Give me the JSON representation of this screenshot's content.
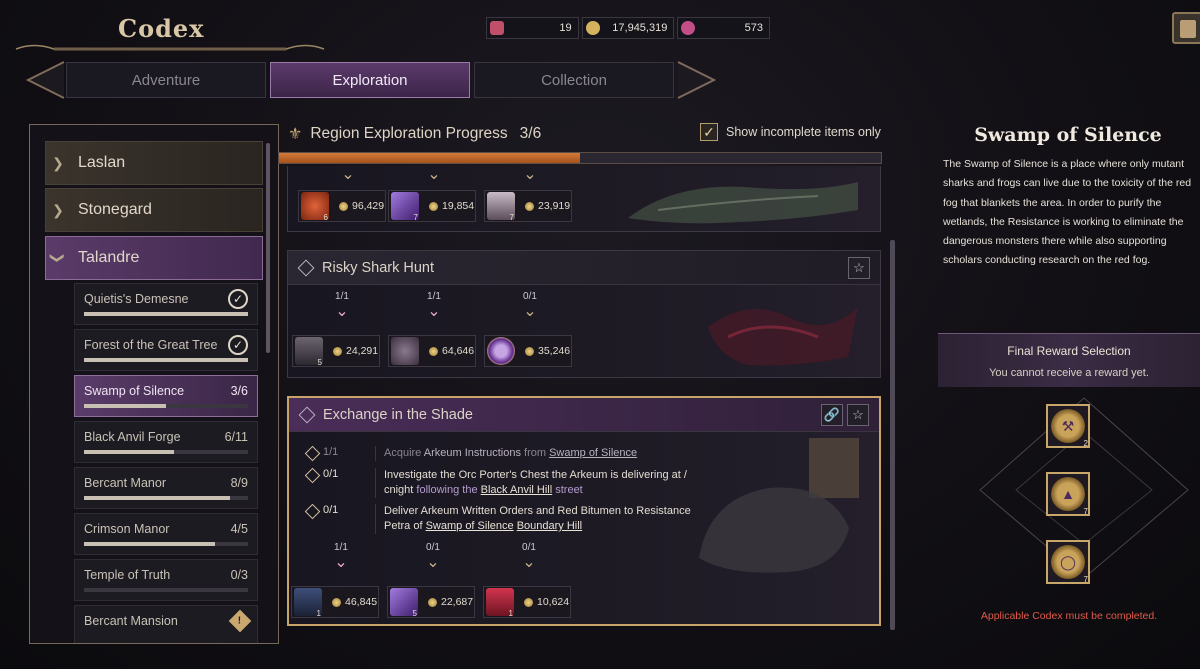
{
  "header": {
    "title": "Codex",
    "currencies": [
      {
        "icon": "scroll-icon",
        "value": "19",
        "color": "#c0506a"
      },
      {
        "icon": "gold-coin-icon",
        "value": "17,945,319",
        "color": "#d4b25e"
      },
      {
        "icon": "gem-icon",
        "value": "573",
        "color": "#c24d87"
      }
    ]
  },
  "tabs": [
    {
      "label": "Adventure",
      "active": false
    },
    {
      "label": "Exploration",
      "active": true
    },
    {
      "label": "Collection",
      "active": false
    }
  ],
  "regions": [
    {
      "label": "Laslan",
      "open": false
    },
    {
      "label": "Stonegard",
      "open": false
    },
    {
      "label": "Talandre",
      "open": true
    }
  ],
  "subregions": [
    {
      "label": "Quietis's Demesne",
      "progress": "",
      "complete": true,
      "fill": 1.0
    },
    {
      "label": "Forest of the Great Tree",
      "progress": "",
      "complete": true,
      "fill": 1.0
    },
    {
      "label": "Swamp of Silence",
      "progress": "3/6",
      "complete": false,
      "fill": 0.5,
      "active": true
    },
    {
      "label": "Black Anvil Forge",
      "progress": "6/11",
      "complete": false,
      "fill": 0.55
    },
    {
      "label": "Bercant Manor",
      "progress": "8/9",
      "complete": false,
      "fill": 0.89
    },
    {
      "label": "Crimson Manor",
      "progress": "4/5",
      "complete": false,
      "fill": 0.8
    },
    {
      "label": "Temple of Truth",
      "progress": "0/3",
      "complete": false,
      "fill": 0.0
    },
    {
      "label": "Bercant Mansion",
      "progress": "",
      "complete": false,
      "warning": true
    }
  ],
  "exploration": {
    "title": "Region Exploration Progress",
    "progress": "3/6",
    "progress_fill": 0.5,
    "show_incomplete_label": "Show incomplete items only",
    "show_incomplete_checked": true
  },
  "cards": {
    "top": {
      "slots": [
        {
          "item_color": "#b8431c",
          "qty": "6",
          "value": "96,429"
        },
        {
          "item_color": "#6a3fa0",
          "qty": "7",
          "value": "19,854"
        },
        {
          "item_color": "#7a6a80",
          "qty": "7",
          "value": "23,919"
        }
      ]
    },
    "shark": {
      "title": "Risky Shark Hunt",
      "tiers": [
        "1/1",
        "1/1",
        "0/1"
      ],
      "slots": [
        {
          "item_color": "#4b4550",
          "qty": "5",
          "value": "24,291"
        },
        {
          "item_color": "#5a4a5e",
          "qty": "",
          "value": "64,646"
        },
        {
          "item_color": "#7c3fb0",
          "qty": "",
          "value": "35,246"
        }
      ]
    },
    "exchange": {
      "title": "Exchange in the Shade",
      "tasks": [
        {
          "progress": "1/1",
          "done": true,
          "p1": "Acquire ",
          "p2": "Arkeum Instructions",
          "p3": " from ",
          "p4": "Swamp of Silence",
          "p5": ""
        },
        {
          "progress": "0/1",
          "done": false,
          "p1": "Investigate the Orc Porter's Chest the Arkeum is delivering  at /",
          "p2": "cnight ",
          "p3": "following the ",
          "p4": "Black Anvil Hill",
          "p5": " street"
        },
        {
          "progress": "0/1",
          "done": false,
          "p1": "Deliver Arkeum Written Orders and Red Bitumen to Resistance",
          "p2": "Petra of ",
          "p3": "Swamp of Silence",
          "p4": "Boundary Hill",
          "p5": ""
        }
      ],
      "tiers": [
        "1/1",
        "0/1",
        "0/1"
      ],
      "slots": [
        {
          "item_color": "#2f3a55",
          "qty": "1",
          "value": "46,845"
        },
        {
          "item_color": "#6a3fa0",
          "qty": "5",
          "value": "22,687"
        },
        {
          "item_color": "#a8243a",
          "qty": "1",
          "value": "10,624"
        }
      ]
    }
  },
  "detail": {
    "title": "Swamp of Silence",
    "description": "The Swamp of Silence is a place where only mutant sharks and frogs can live due to the toxicity of the red fog that blankets the area. In order to purify the wetlands, the Resistance is working to eliminate the dangerous monsters there while also supporting scholars conducting research on the red fog.",
    "reward_title": "Final Reward Selection",
    "reward_status": "You cannot receive a reward yet.",
    "rewards": [
      {
        "icon": "pickaxe-icon",
        "qty": "2"
      },
      {
        "icon": "armor-icon",
        "qty": "7"
      },
      {
        "icon": "ring-icon",
        "qty": "7"
      }
    ],
    "note": "Applicable Codex must be completed."
  }
}
